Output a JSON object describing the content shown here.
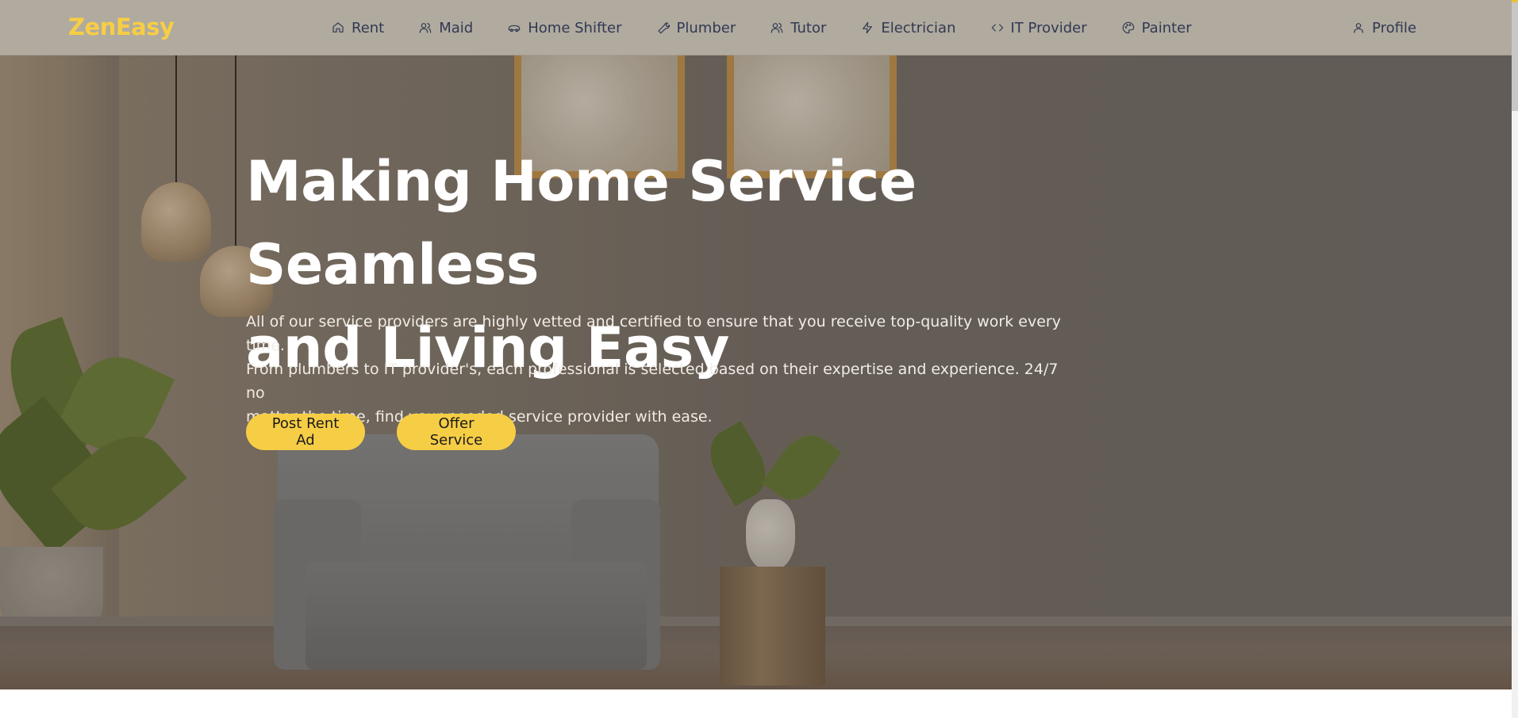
{
  "brand": {
    "name": "ZenEasy",
    "color": "#f6ce45"
  },
  "nav": {
    "items": [
      {
        "label": "Rent",
        "icon": "home-icon"
      },
      {
        "label": "Maid",
        "icon": "users-icon"
      },
      {
        "label": "Home Shifter",
        "icon": "truck-icon"
      },
      {
        "label": "Plumber",
        "icon": "wrench-icon"
      },
      {
        "label": "Tutor",
        "icon": "users-icon"
      },
      {
        "label": "Electrician",
        "icon": "bolt-icon"
      },
      {
        "label": "IT Provider",
        "icon": "code-icon"
      },
      {
        "label": "Painter",
        "icon": "palette-icon"
      }
    ],
    "profile": {
      "label": "Profile",
      "icon": "user-icon"
    }
  },
  "hero": {
    "title_line1": "Making Home Service Seamless",
    "title_line2": "and Living Easy",
    "description_line1": "All of our service providers are highly vetted and certified to ensure that you receive top-quality work every time.",
    "description_line2": "From plumbers to IT provider's, each professional is selected based on their expertise and experience. 24/7 no",
    "description_line3": "matter the time, find your needed service provider with ease.",
    "buttons": {
      "post_rent_ad": "Post Rent Ad",
      "offer_service": "Offer Service"
    }
  },
  "colors": {
    "navbar_bg": "#b1aa9f",
    "nav_text": "#2f3a52",
    "accent": "#f6ce45"
  }
}
